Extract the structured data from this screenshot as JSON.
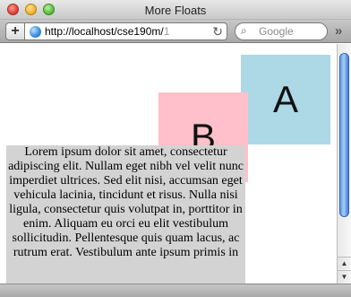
{
  "window": {
    "title": "More Floats"
  },
  "toolbar": {
    "add_label": "+",
    "url_visible": "http://localhost/cse190m/",
    "url_dim": "1",
    "reload_icon": "↻",
    "search_placeholder": "Google",
    "search_icon": "⌕",
    "overflow_icon": "»"
  },
  "content": {
    "box_a": "A",
    "box_b": "B",
    "paragraph": "Lorem ipsum dolor sit amet, consectetur adipiscing elit. Nullam eget nibh vel velit nunc imperdiet ultrices. Sed elit nisi, accumsan eget vehicula lacinia, tincidunt et risus. Nulla nisi ligula, consectetur quis volutpat in, porttitor in enim. Aliquam eu orci eu elit vestibulum sollicitudin. Pellentesque quis quam lacus, ac rutrum erat. Vestibulum ante ipsum primis in"
  },
  "scrollbar": {
    "up_icon": "▲",
    "down_icon": "▼"
  },
  "colors": {
    "box_a": "#add8e6",
    "box_b": "#ffc0cb",
    "paragraph_bg": "#d3d3d3"
  }
}
